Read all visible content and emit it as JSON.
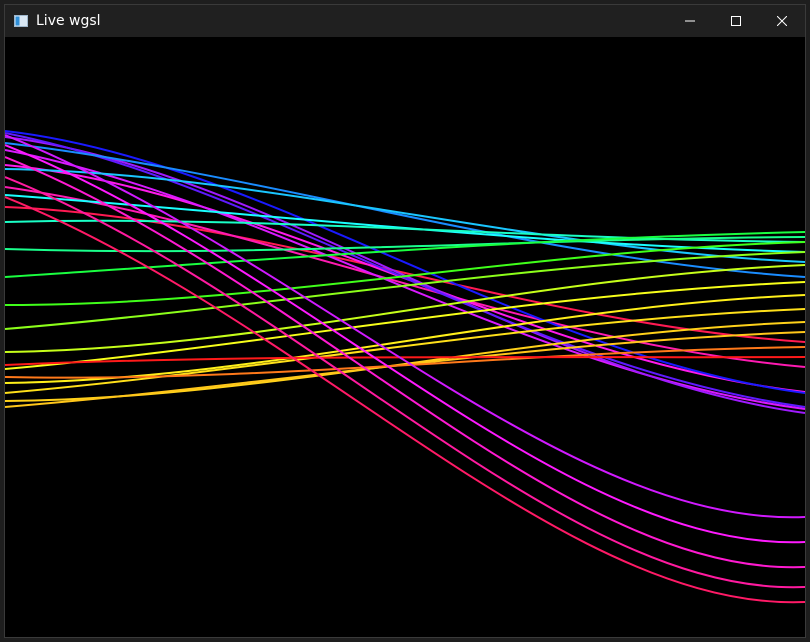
{
  "window": {
    "title": "Live wgsl",
    "icon": "app-window-icon",
    "controls": [
      {
        "name": "minimize-button",
        "icon": "minimize-icon"
      },
      {
        "name": "maximize-button",
        "icon": "maximize-icon"
      },
      {
        "name": "close-button",
        "icon": "close-icon"
      }
    ]
  },
  "colors": {
    "background": "#000000",
    "titlebar": "#202020"
  }
}
